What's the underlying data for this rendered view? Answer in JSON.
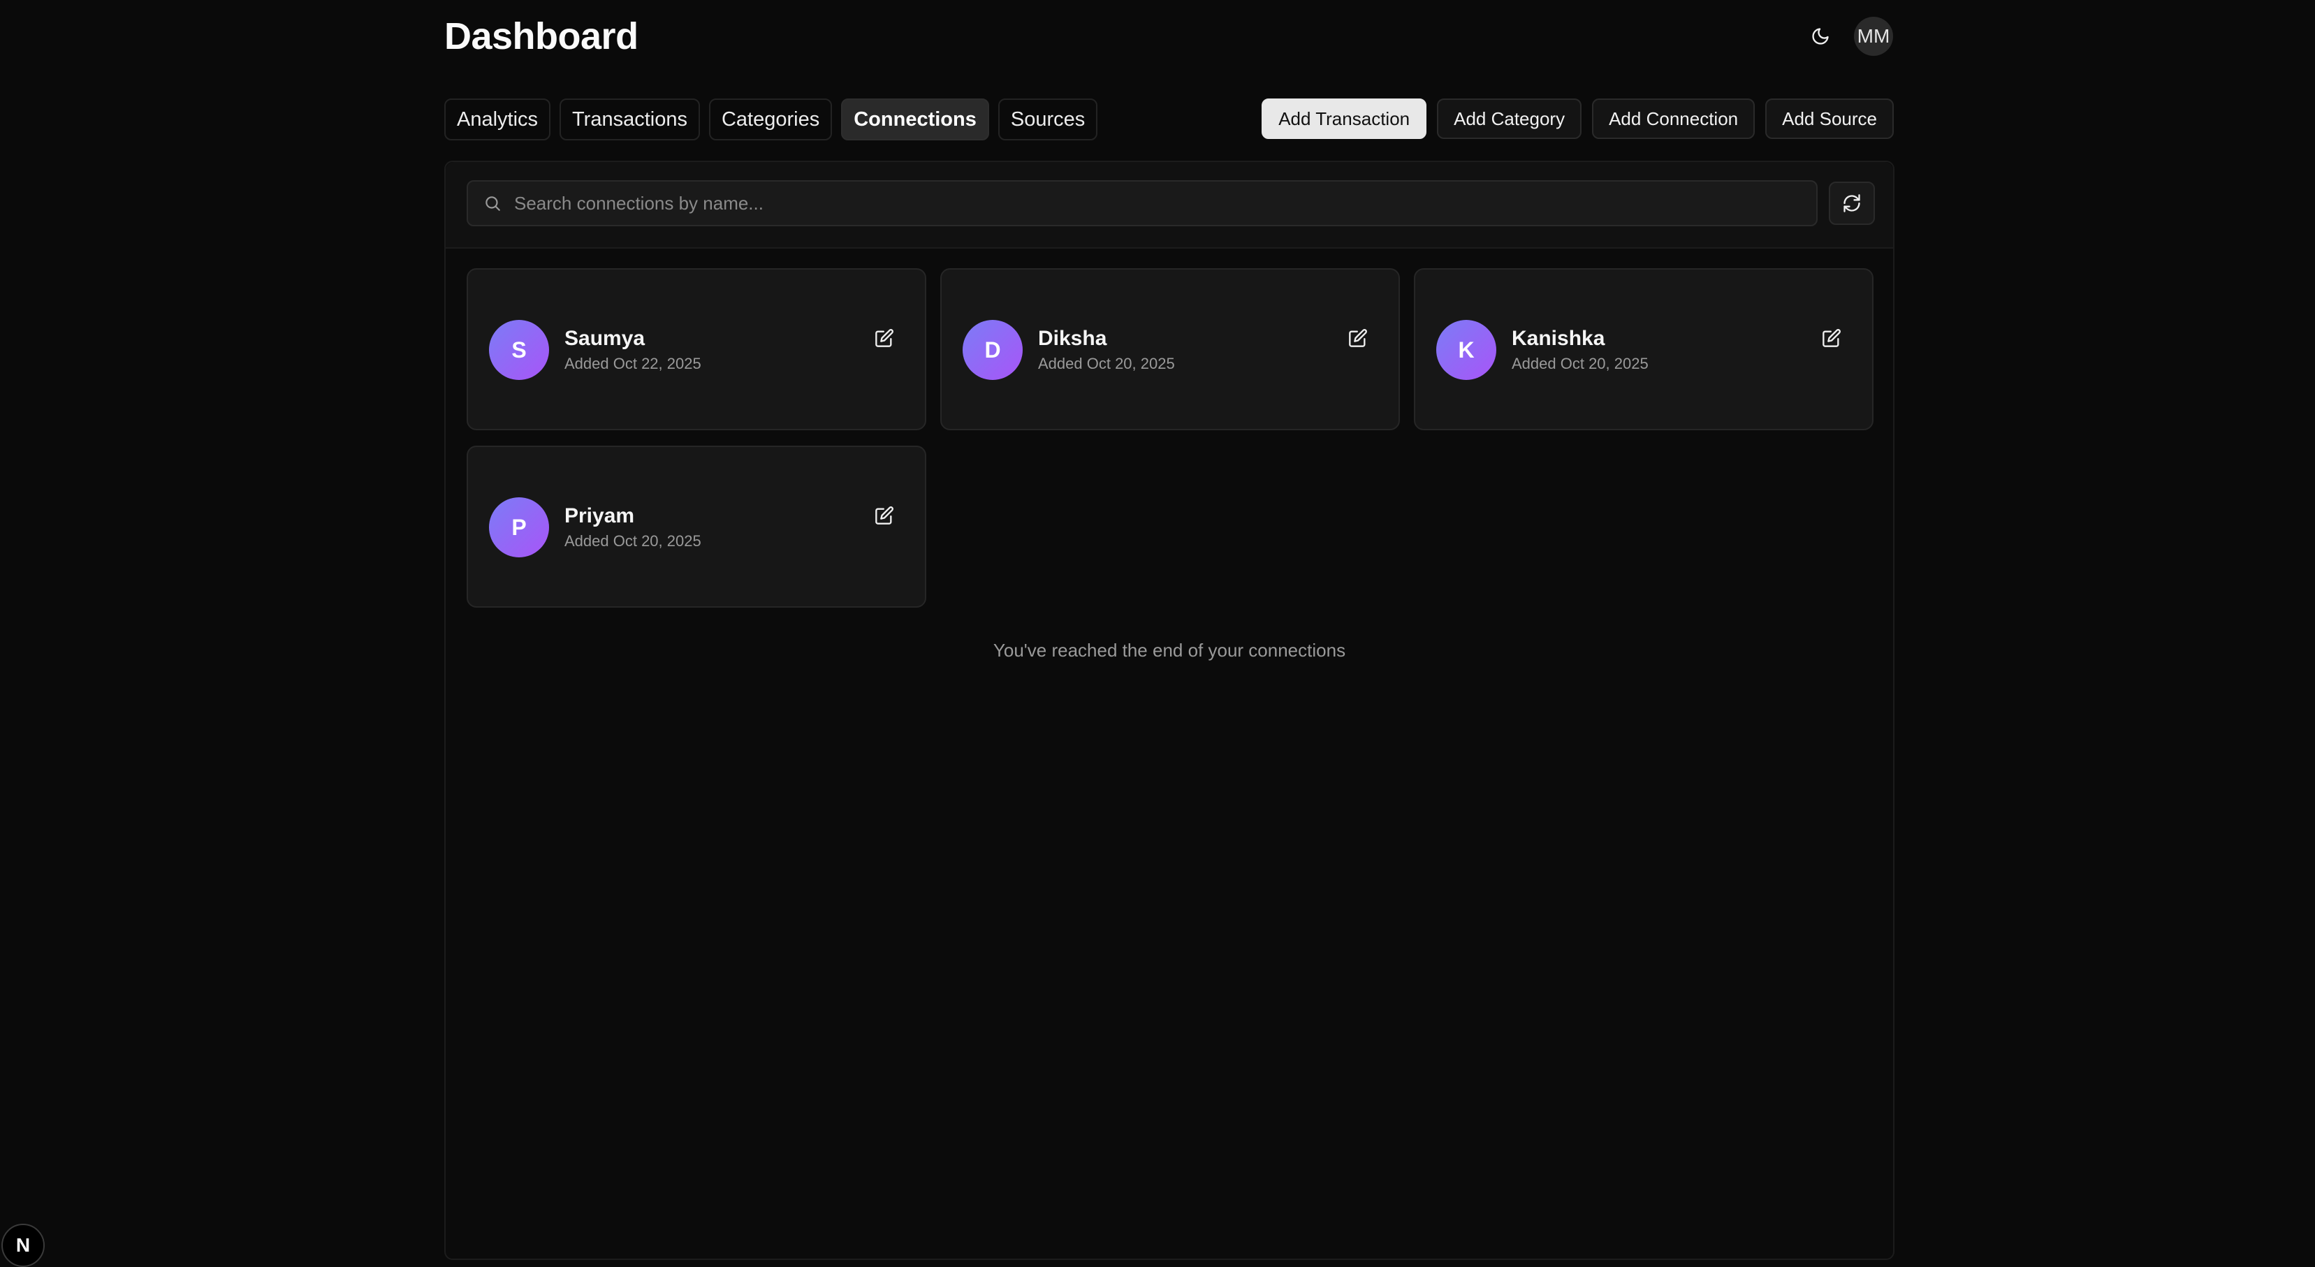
{
  "header": {
    "title": "Dashboard",
    "theme_icon": "moon-icon",
    "user_initials": "MM"
  },
  "tabs": [
    {
      "label": "Analytics",
      "active": false
    },
    {
      "label": "Transactions",
      "active": false
    },
    {
      "label": "Categories",
      "active": false
    },
    {
      "label": "Connections",
      "active": true
    },
    {
      "label": "Sources",
      "active": false
    }
  ],
  "actions": {
    "add_transaction": "Add Transaction",
    "add_category": "Add Category",
    "add_connection": "Add Connection",
    "add_source": "Add Source"
  },
  "search": {
    "placeholder": "Search connections by name...",
    "value": "",
    "icon": "search-icon",
    "refresh_icon": "refresh-icon"
  },
  "connections": [
    {
      "initial": "S",
      "name": "Saumya",
      "added": "Added Oct 22, 2025"
    },
    {
      "initial": "D",
      "name": "Diksha",
      "added": "Added Oct 20, 2025"
    },
    {
      "initial": "K",
      "name": "Kanishka",
      "added": "Added Oct 20, 2025"
    },
    {
      "initial": "P",
      "name": "Priyam",
      "added": "Added Oct 20, 2025"
    }
  ],
  "end_message": "You've reached the end of your connections",
  "next_badge": "N",
  "colors": {
    "background": "#0a0a0a",
    "card": "#171717",
    "avatar_gradient_start": "#7c7cf6",
    "avatar_gradient_end": "#a855f7",
    "primary_button": "#e8e8e8"
  }
}
